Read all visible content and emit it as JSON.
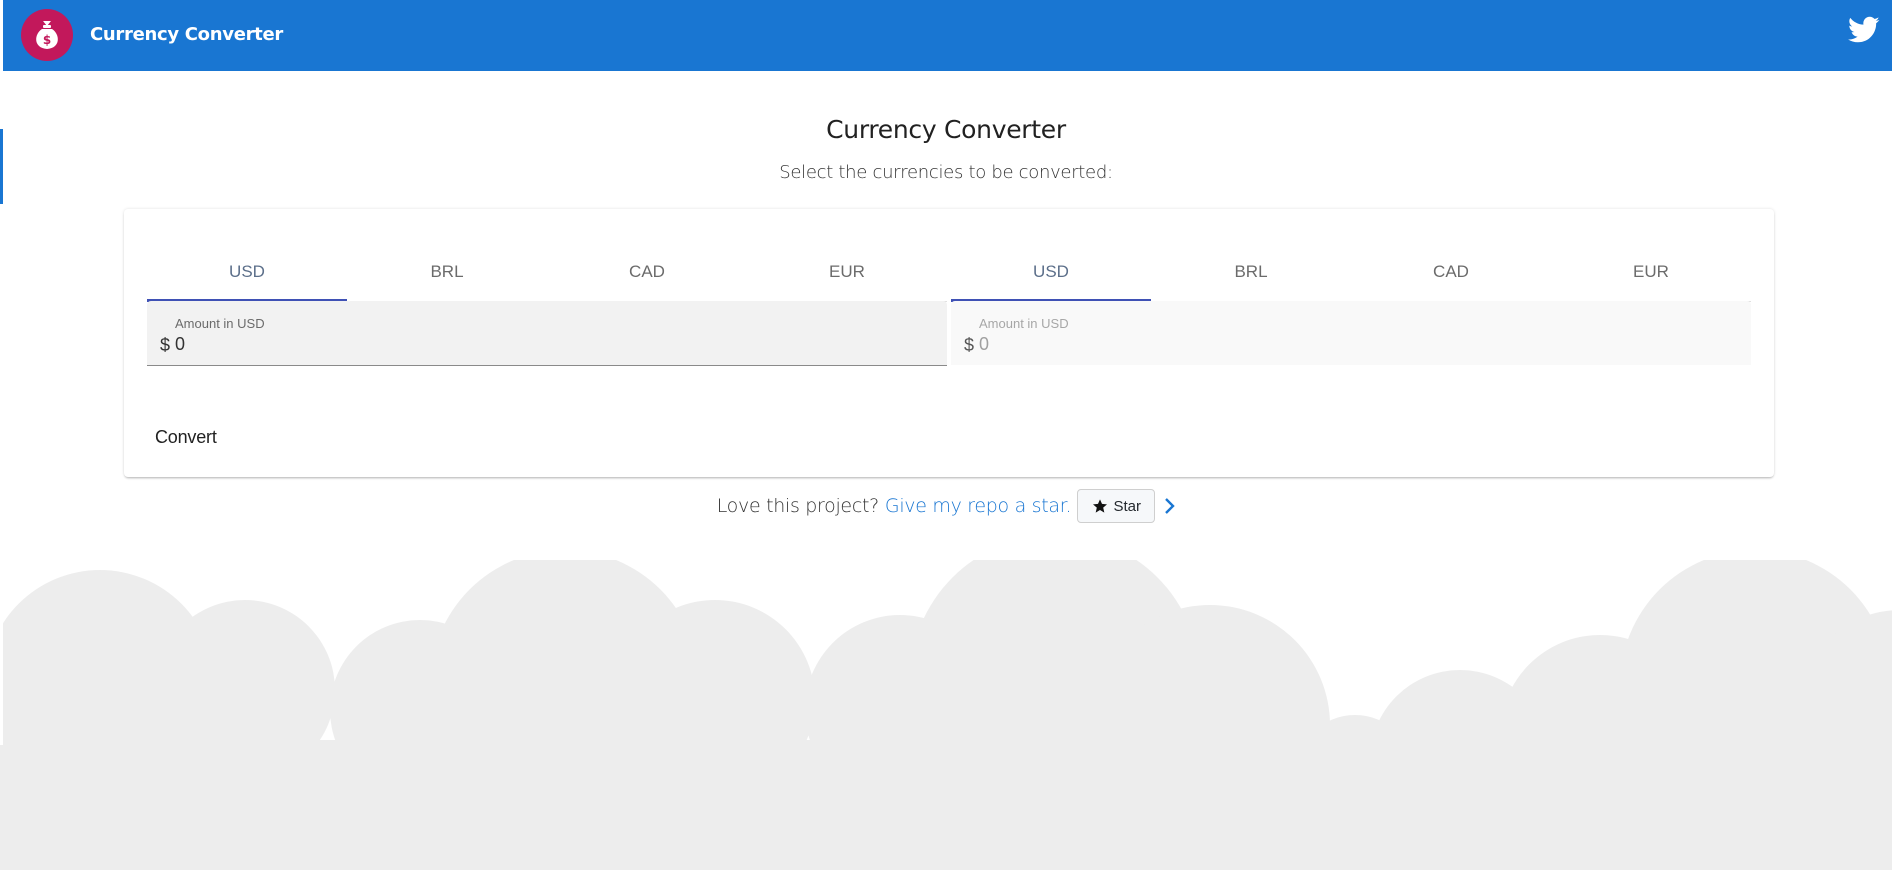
{
  "app": {
    "title": "Currency Converter"
  },
  "header": {
    "twitter_icon": "twitter-icon",
    "logo_icon": "money-bag-icon"
  },
  "main": {
    "title": "Currency Converter",
    "subtitle": "Select the currencies to be converted:"
  },
  "converter": {
    "from_tabs": [
      {
        "label": "USD",
        "active": true
      },
      {
        "label": "BRL",
        "active": false
      },
      {
        "label": "CAD",
        "active": false
      },
      {
        "label": "EUR",
        "active": false
      }
    ],
    "to_tabs": [
      {
        "label": "USD",
        "active": true
      },
      {
        "label": "BRL",
        "active": false
      },
      {
        "label": "CAD",
        "active": false
      },
      {
        "label": "EUR",
        "active": false
      }
    ],
    "from_field": {
      "label": "Amount in USD",
      "prefix": "$",
      "value": "0"
    },
    "to_field": {
      "label": "Amount in USD",
      "prefix": "$",
      "value": "0"
    },
    "convert_label": "Convert"
  },
  "footer": {
    "love_text": "Love this project?",
    "link_text": "Give my repo a star.",
    "star_label": "Star"
  },
  "colors": {
    "primary": "#1976d2",
    "tab_indicator": "#3f51b5",
    "logo_bg": "#c2185b",
    "cloud": "#ededed"
  }
}
